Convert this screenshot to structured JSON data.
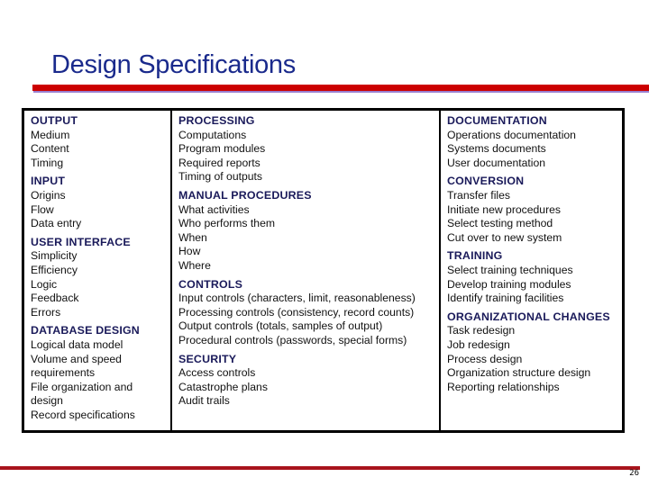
{
  "slide": {
    "title": "Design Specifications",
    "page_number": "26",
    "accent_color": "#cc0000",
    "title_color": "#1a2a8c"
  },
  "columns": [
    {
      "sections": [
        {
          "heading": "OUTPUT",
          "items": [
            "Medium",
            "Content",
            "Timing"
          ]
        },
        {
          "heading": "INPUT",
          "items": [
            "Origins",
            "Flow",
            "Data entry"
          ]
        },
        {
          "heading": "USER INTERFACE",
          "items": [
            "Simplicity",
            "Efficiency",
            "Logic",
            "Feedback",
            "Errors"
          ]
        },
        {
          "heading": "DATABASE DESIGN",
          "items": [
            "Logical data model",
            "Volume and speed requirements",
            "File organization and design",
            "Record specifications"
          ]
        }
      ]
    },
    {
      "sections": [
        {
          "heading": "PROCESSING",
          "items": [
            "Computations",
            "Program modules",
            "Required reports",
            "Timing of outputs"
          ]
        },
        {
          "heading": "MANUAL PROCEDURES",
          "items": [
            "What activities",
            "Who performs them",
            "When",
            "How",
            "Where"
          ]
        },
        {
          "heading": "CONTROLS",
          "items": [
            "Input controls (characters, limit, reasonableness)",
            "Processing controls (consistency, record counts)",
            "Output controls (totals, samples of output)",
            "Procedural controls (passwords, special forms)"
          ]
        },
        {
          "heading": "SECURITY",
          "items": [
            "Access controls",
            "Catastrophe plans",
            "Audit trails"
          ]
        }
      ]
    },
    {
      "sections": [
        {
          "heading": "DOCUMENTATION",
          "items": [
            "Operations documentation",
            "Systems documents",
            "User documentation"
          ]
        },
        {
          "heading": "CONVERSION",
          "items": [
            "Transfer files",
            "Initiate new procedures",
            "Select testing method",
            "Cut over to new system"
          ]
        },
        {
          "heading": "TRAINING",
          "items": [
            "Select training techniques",
            "Develop training modules",
            "Identify training facilities"
          ]
        },
        {
          "heading": "ORGANIZATIONAL CHANGES",
          "items": [
            "Task redesign",
            "Job redesign",
            "Process design",
            "Organization structure design",
            "Reporting relationships"
          ]
        }
      ]
    }
  ]
}
